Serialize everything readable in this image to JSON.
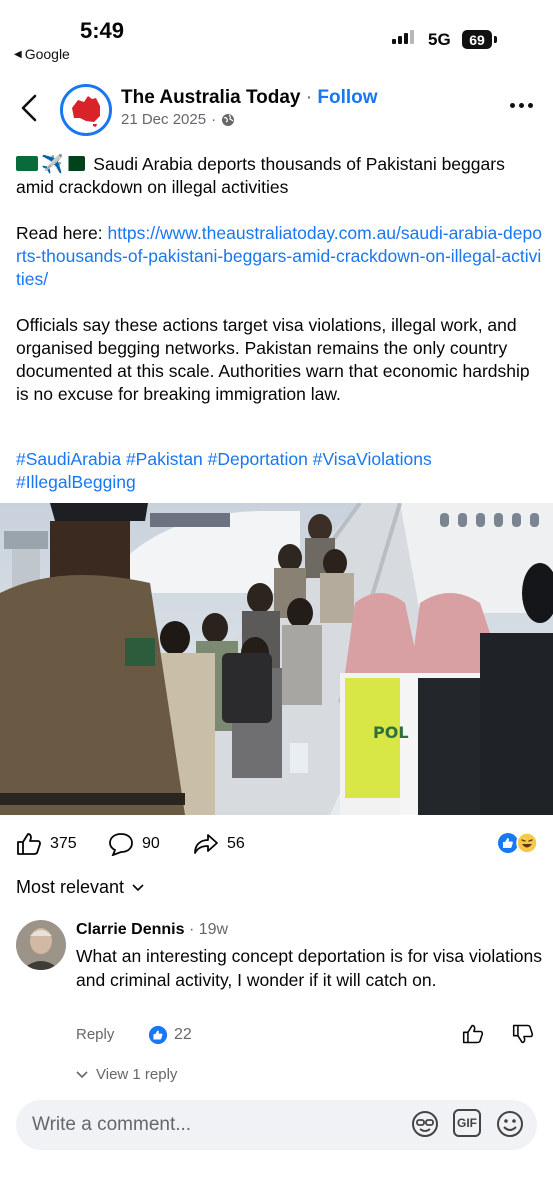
{
  "status_bar": {
    "time": "5:49",
    "back_app": "Google",
    "network": "5G",
    "battery": "69"
  },
  "post": {
    "page_name": "The Australia Today",
    "separator": "·",
    "follow_label": "Follow",
    "date": "21 Dec 2025",
    "avatar_text": "AUSTRALIA TODAY",
    "headline": "Saudi Arabia deports thousands of Pakistani beggars amid crackdown on illegal activities",
    "read_here_label": "Read here:",
    "link": "https://www.theaustraliatoday.com.au/saudi-arabia-deports-thousands-of-pakistani-beggars-amid-crackdown-on-illegal-activities/",
    "body": "Officials say these actions target visa violations, illegal work, and organised begging networks. Pakistan remains the only country documented at this scale. Authorities warn that economic hardship is no excuse for breaking immigration law.",
    "hashtags": "#SaudiArabia #Pakistan #Deportation #VisaViolations #IllegalBegging",
    "image_vest_text": "POL"
  },
  "reactions": {
    "likes": "375",
    "comments": "90",
    "shares": "56"
  },
  "comments_section": {
    "sort_label": "Most relevant",
    "comment": {
      "author": "Clarrie Dennis",
      "time": "· 19w",
      "text": "What an interesting concept deportation is for visa violations and criminal activity, I wonder if it will catch on.",
      "reply_label": "Reply",
      "like_count": "22"
    },
    "view_replies": "View 1 reply"
  },
  "composer": {
    "placeholder": "Write a comment...",
    "gif_label": "GIF"
  },
  "colors": {
    "accent": "#1877F2",
    "secondary_text": "#65676b",
    "composer_bg": "#f0f2f5"
  },
  "icons": [
    "chevron-left-icon",
    "globe-icon",
    "more-icon",
    "like-icon",
    "comment-icon",
    "share-icon",
    "sticker-icon",
    "gif-icon",
    "emoji-icon"
  ]
}
